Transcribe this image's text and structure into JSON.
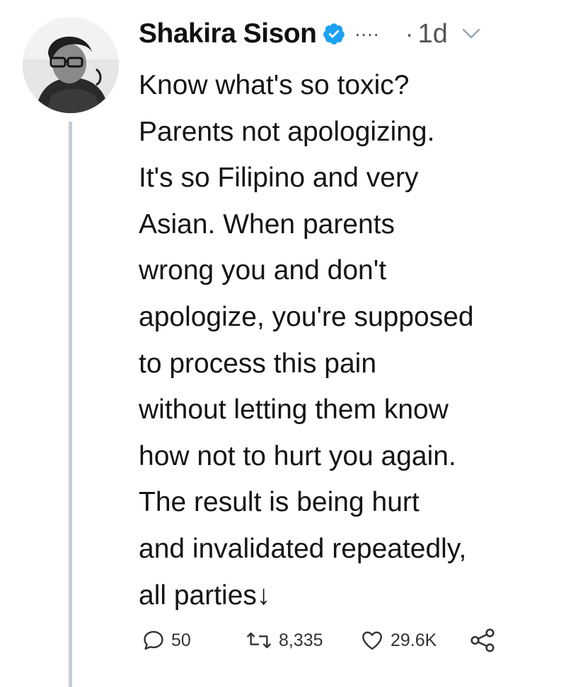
{
  "author": {
    "name": "Shakira Sison",
    "verified": true,
    "more_glyph": "....",
    "separator": "·",
    "time": "1d"
  },
  "tweet": {
    "lines": [
      "Know what's so toxic?",
      "Parents not apologizing.",
      "It's so Filipino and very",
      "Asian. When parents",
      "wrong you and don't",
      "apologize, you're supposed",
      "to process this pain",
      "without letting them know",
      "how not to hurt you again.",
      "The result is being hurt",
      "and invalidated repeatedly,",
      "all parties↓"
    ]
  },
  "actions": {
    "replies": "50",
    "retweets": "8,335",
    "likes": "29.6K"
  },
  "icons": {
    "verified": "verified-badge-icon",
    "chevron": "chevron-down-icon",
    "reply": "reply-icon",
    "retweet": "retweet-icon",
    "like": "heart-icon",
    "share": "share-icon"
  },
  "colors": {
    "verified": "#1da1f2",
    "thread_line": "#c7ced6",
    "text": "#141414",
    "muted": "#555555"
  }
}
